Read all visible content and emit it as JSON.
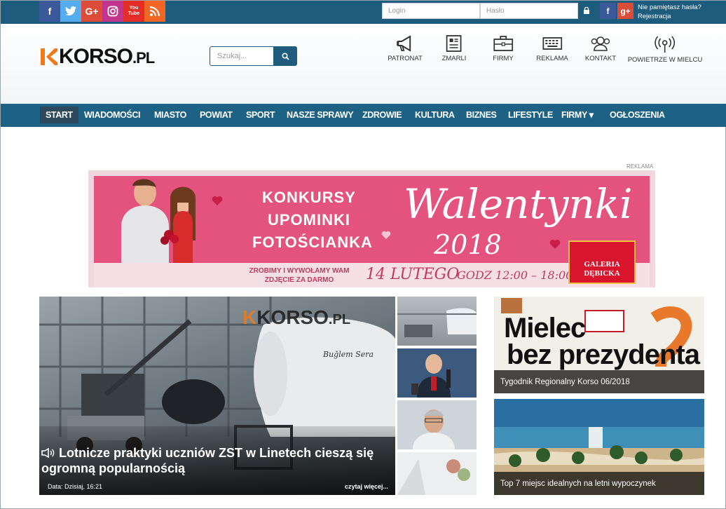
{
  "topbar": {
    "social": [
      "f",
      "t",
      "G+",
      "ig",
      "You Tube",
      "rss"
    ],
    "login_placeholder": "Login",
    "password_placeholder": "Hasło",
    "fb_label": "f",
    "gplus_label": "g+",
    "forgot_password": "Nie pamiętasz hasła?",
    "register": "Rejestracja"
  },
  "header": {
    "logo_main": "KORSO",
    "logo_suffix": ".PL",
    "search_placeholder": "Szukaj...",
    "icons": [
      {
        "label": "PATRONAT",
        "icon": "megaphone-icon"
      },
      {
        "label": "ZMARLI",
        "icon": "newspaper-icon"
      },
      {
        "label": "FIRMY",
        "icon": "briefcase-icon"
      },
      {
        "label": "REKLAMA",
        "icon": "keyboard-icon"
      },
      {
        "label": "KONTAKT",
        "icon": "users-icon"
      },
      {
        "label": "POWIETRZE W MIELCU",
        "icon": "broadcast-icon"
      }
    ]
  },
  "nav": {
    "items": [
      "START",
      "WIADOMOŚCI",
      "MIASTO",
      "POWIAT",
      "SPORT",
      "NASZE SPRAWY",
      "ZDROWIE",
      "KULTURA",
      "BIZNES",
      "LIFESTYLE",
      "FIRMY ▾",
      "OGŁOSZENIA"
    ]
  },
  "ad": {
    "label": "REKLAMA",
    "lines": [
      "KONKURSY",
      "UPOMINKI",
      "FOTOŚCIANKA"
    ],
    "script_title": "Walentynki",
    "script_year": "2018",
    "bottom_left": "ZROBIMY I WYWOŁAMY WAM ZDJĘCIE ZA DARMO",
    "bottom_date": "14 LUTEGO",
    "bottom_time": "GODZ 12:00 – 18:00",
    "brand": "GALERIA DĘBICKA"
  },
  "feature": {
    "watermark_main": "KORSO",
    "watermark_suffix": ".PL",
    "plane_text": "Buğlem Sera",
    "title": "Lotnicze praktyki uczniów ZST w Linetech cieszą się ogromną popularnością",
    "date": "Data: Dzisiaj, 16:21",
    "more": "czytaj więcej..."
  },
  "side": [
    {
      "caption": "Tygodnik Regionalny Korso 06/2018",
      "headline_line1": "Mielec",
      "headline_line2": "bez prezydenta"
    },
    {
      "caption": "Top 7 miejsc idealnych na letni wypoczynek"
    }
  ],
  "colors": {
    "primary": "#1d6285",
    "dark": "#2d4a5c",
    "ad_pink": "#e3537e",
    "logo_orange": "#f07a1a"
  }
}
